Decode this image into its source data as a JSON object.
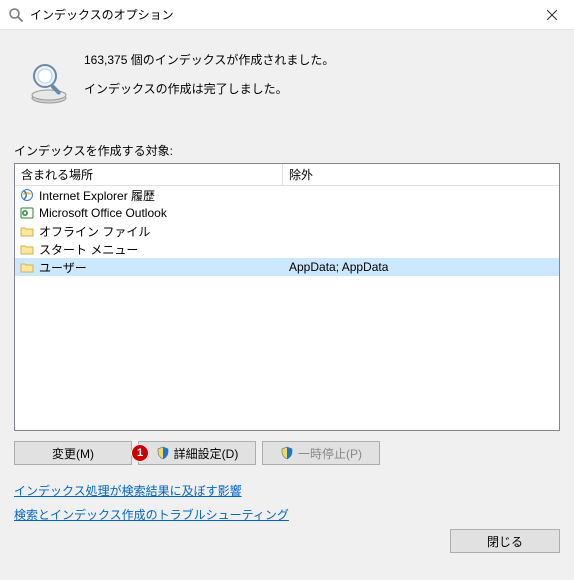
{
  "window": {
    "title": "インデックスのオプション",
    "icon": "search-icon"
  },
  "status": {
    "count_text": "163,375 個のインデックスが作成されました。",
    "completion_text": "インデックスの作成は完了しました。"
  },
  "section_label": "インデックスを作成する対象:",
  "columns": {
    "location": "含まれる場所",
    "exclude": "除外"
  },
  "locations": [
    {
      "icon": "ie-icon",
      "label": "Internet Explorer 履歴",
      "exclude": ""
    },
    {
      "icon": "outlook-icon",
      "label": "Microsoft Office Outlook",
      "exclude": ""
    },
    {
      "icon": "folder-icon",
      "label": "オフライン ファイル",
      "exclude": ""
    },
    {
      "icon": "folder-icon",
      "label": "スタート メニュー",
      "exclude": ""
    },
    {
      "icon": "folder-icon",
      "label": "ユーザー",
      "exclude": "AppData; AppData",
      "selected": true
    }
  ],
  "buttons": {
    "modify": "変更(M)",
    "advanced": "詳細設定(D)",
    "pause": "一時停止(P)",
    "close": "閉じる"
  },
  "annotations": {
    "advanced_badge": "1"
  },
  "links": {
    "impact": "インデックス処理が検索結果に及ぼす影響",
    "troubleshoot": "検索とインデックス作成のトラブルシューティング"
  }
}
